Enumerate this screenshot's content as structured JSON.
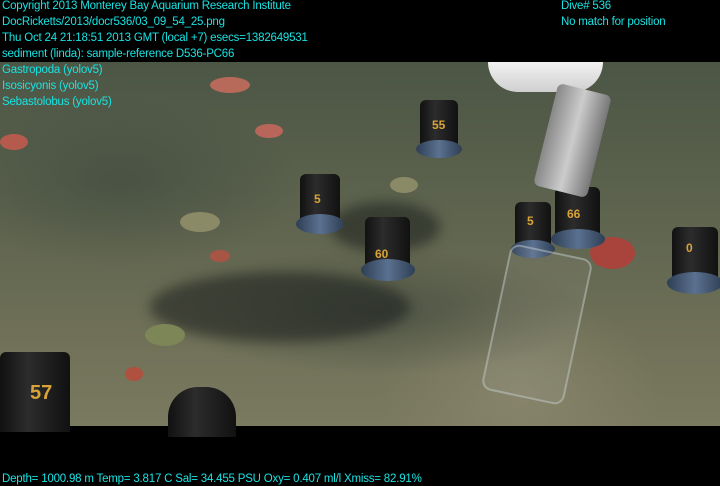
{
  "overlay_top_left": {
    "copyright": "Copyright 2013 Monterey Bay Aquarium Research Institute",
    "file": "DocRicketts/2013/docr536/03_09_54_25.png",
    "timestamp": "Thu Oct 24 21:18:51 2013 GMT (local +7)  esecs=1382649531",
    "annotation": "sediment (linda): sample-reference D536-PC66",
    "detections": [
      "Gastropoda (yolov5)",
      "Isosicyonis (yolov5)",
      "Sebastolobus (yolov5)"
    ]
  },
  "overlay_top_right": {
    "dive": "Dive# 536",
    "position": "No match for position"
  },
  "overlay_bottom": {
    "sensors": "Depth= 1000.98 m  Temp= 3.817 C  Sal= 34.455 PSU  Oxy= 0.407 ml/l  Xmiss= 82.91%"
  },
  "colors": {
    "overlay_text": "#19e3e3",
    "background": "#000000"
  }
}
